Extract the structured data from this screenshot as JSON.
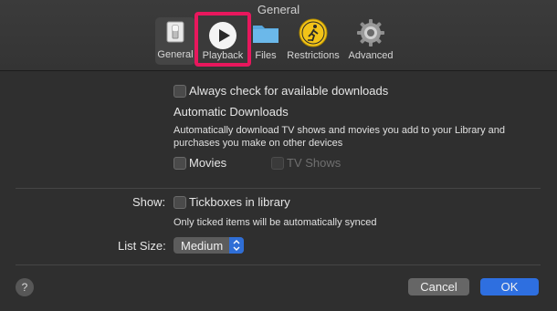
{
  "window": {
    "title": "General"
  },
  "toolbar": {
    "items": [
      {
        "label": "General",
        "icon": "switch-icon"
      },
      {
        "label": "Playback",
        "icon": "play-icon",
        "selected": true
      },
      {
        "label": "Files",
        "icon": "folder-icon"
      },
      {
        "label": "Restrictions",
        "icon": "restrictions-icon"
      },
      {
        "label": "Advanced",
        "icon": "gear-icon"
      }
    ],
    "highlight_color": "#e8175d"
  },
  "downloads": {
    "always_check_label": "Always check for available downloads",
    "always_check_checked": false,
    "heading": "Automatic Downloads",
    "description_line1": "Automatically download TV shows and movies you add to your Library and",
    "description_line2": "purchases you make on other devices",
    "movies_label": "Movies",
    "movies_checked": false,
    "tvshows_label": "TV Shows",
    "tvshows_checked": false
  },
  "show": {
    "label": "Show:",
    "tickboxes_label": "Tickboxes in library",
    "tickboxes_checked": false,
    "note": "Only ticked items will be automatically synced"
  },
  "list_size": {
    "label": "List Size:",
    "value": "Medium"
  },
  "footer": {
    "help_symbol": "?",
    "cancel_label": "Cancel",
    "ok_label": "OK",
    "accent": "#2e6fe0"
  }
}
